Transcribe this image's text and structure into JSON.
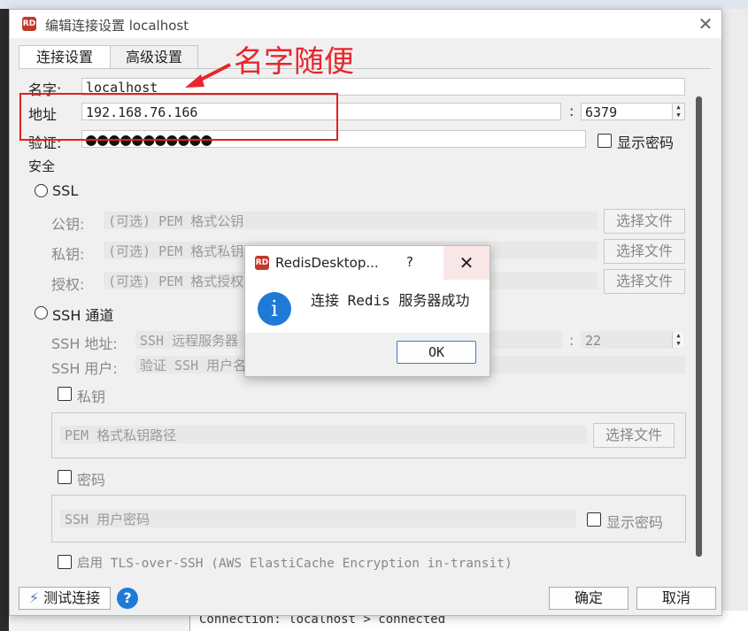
{
  "window": {
    "title": "编辑连接设置 localhost",
    "app_icon_text": "RD",
    "close_glyph": "✕",
    "tabs": [
      {
        "label": "连接设置"
      },
      {
        "label": "高级设置"
      }
    ]
  },
  "connection": {
    "name_label": "名字:",
    "name_value": "localhost",
    "host_label": "地址",
    "host_value": "192.168.76.166",
    "port_sep": ":",
    "port_value": "6379",
    "auth_label": "验证:",
    "auth_value": "●●●●●●●●●●●",
    "show_password": "显示密码"
  },
  "security": {
    "heading": "安全",
    "ssl_label": "SSL",
    "public_key_label": "公钥:",
    "public_key_placeholder": "(可选) PEM 格式公钥",
    "private_key_label": "私钥:",
    "private_key_placeholder": "(可选) PEM 格式私钥",
    "authority_label": "授权:",
    "authority_placeholder": "(可选) PEM 格式授权",
    "choose_file": "选择文件",
    "ssh_label": "SSH 通道",
    "ssh_host_label": "SSH 地址:",
    "ssh_host_placeholder": "SSH 远程服务器",
    "ssh_port_value": "22",
    "ssh_user_label": "SSH 用户:",
    "ssh_user_placeholder": "验证 SSH 用户名",
    "private_key_check": "私钥",
    "pem_path_placeholder": "PEM 格式私钥路径",
    "password_check": "密码",
    "ssh_password_placeholder": "SSH 用户密码",
    "show_password": "显示密码",
    "tls_over_ssh": "启用 TLS-over-SSH (AWS ElastiCache Encryption in-transit)"
  },
  "footer": {
    "test_connection": "测试连接",
    "help": "?",
    "ok": "确定",
    "cancel": "取消"
  },
  "annotation": {
    "text": "名字随便",
    "color": "#e8262d"
  },
  "dialog": {
    "title": "RedisDesktop...",
    "help": "?",
    "close": "✕",
    "info_glyph": "i",
    "message": "连接 Redis 服务器成功",
    "ok": "OK"
  },
  "console": {
    "text": "Connection: localhost > connected"
  }
}
